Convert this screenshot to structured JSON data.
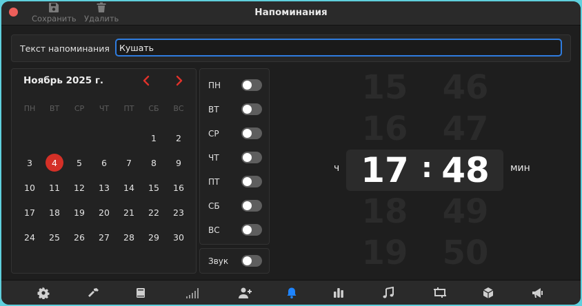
{
  "window": {
    "title": "Напоминания"
  },
  "toolbar": {
    "save_label": "Сохранить",
    "delete_label": "Удалить"
  },
  "reminder": {
    "label": "Текст напоминания",
    "value": "Кушать"
  },
  "calendar": {
    "title": "Ноябрь 2025 г.",
    "weekdays": [
      "ПН",
      "ВТ",
      "СР",
      "ЧТ",
      "ПТ",
      "СБ",
      "ВС"
    ],
    "weeks": [
      [
        "",
        "",
        "",
        "",
        "",
        "1",
        "2"
      ],
      [
        "3",
        "4",
        "5",
        "6",
        "7",
        "8",
        "9"
      ],
      [
        "10",
        "11",
        "12",
        "13",
        "14",
        "15",
        "16"
      ],
      [
        "17",
        "18",
        "19",
        "20",
        "21",
        "22",
        "23"
      ],
      [
        "24",
        "25",
        "26",
        "27",
        "28",
        "29",
        "30"
      ]
    ],
    "selected_day": "4",
    "accent_color": "#d43027"
  },
  "repeat_days": [
    {
      "label": "ПН",
      "on": false
    },
    {
      "label": "ВТ",
      "on": false
    },
    {
      "label": "СР",
      "on": false
    },
    {
      "label": "ЧТ",
      "on": false
    },
    {
      "label": "ПТ",
      "on": false
    },
    {
      "label": "СБ",
      "on": false
    },
    {
      "label": "ВС",
      "on": false
    }
  ],
  "sound": {
    "label": "Звук",
    "on": false
  },
  "time_picker": {
    "hour_unit": "ч",
    "minute_unit": "мин",
    "hours": [
      "15",
      "16",
      "17",
      "18",
      "19"
    ],
    "minutes": [
      "46",
      "47",
      "48",
      "49",
      "50"
    ],
    "selected_hour": "17",
    "selected_minute": "48",
    "separator": ":"
  },
  "tabs": [
    {
      "icon": "gear-icon"
    },
    {
      "icon": "hammer-icon"
    },
    {
      "icon": "book-icon"
    },
    {
      "icon": "signal-icon"
    },
    {
      "icon": "add-user-icon"
    },
    {
      "icon": "bell-icon",
      "active": true
    },
    {
      "icon": "bar-chart-icon"
    },
    {
      "icon": "music-note-icon"
    },
    {
      "icon": "screen-resize-icon"
    },
    {
      "icon": "cube-icon"
    },
    {
      "icon": "megaphone-icon"
    }
  ],
  "colors": {
    "accent_blue": "#2f7de0",
    "active_tab": "#1e84ff"
  }
}
